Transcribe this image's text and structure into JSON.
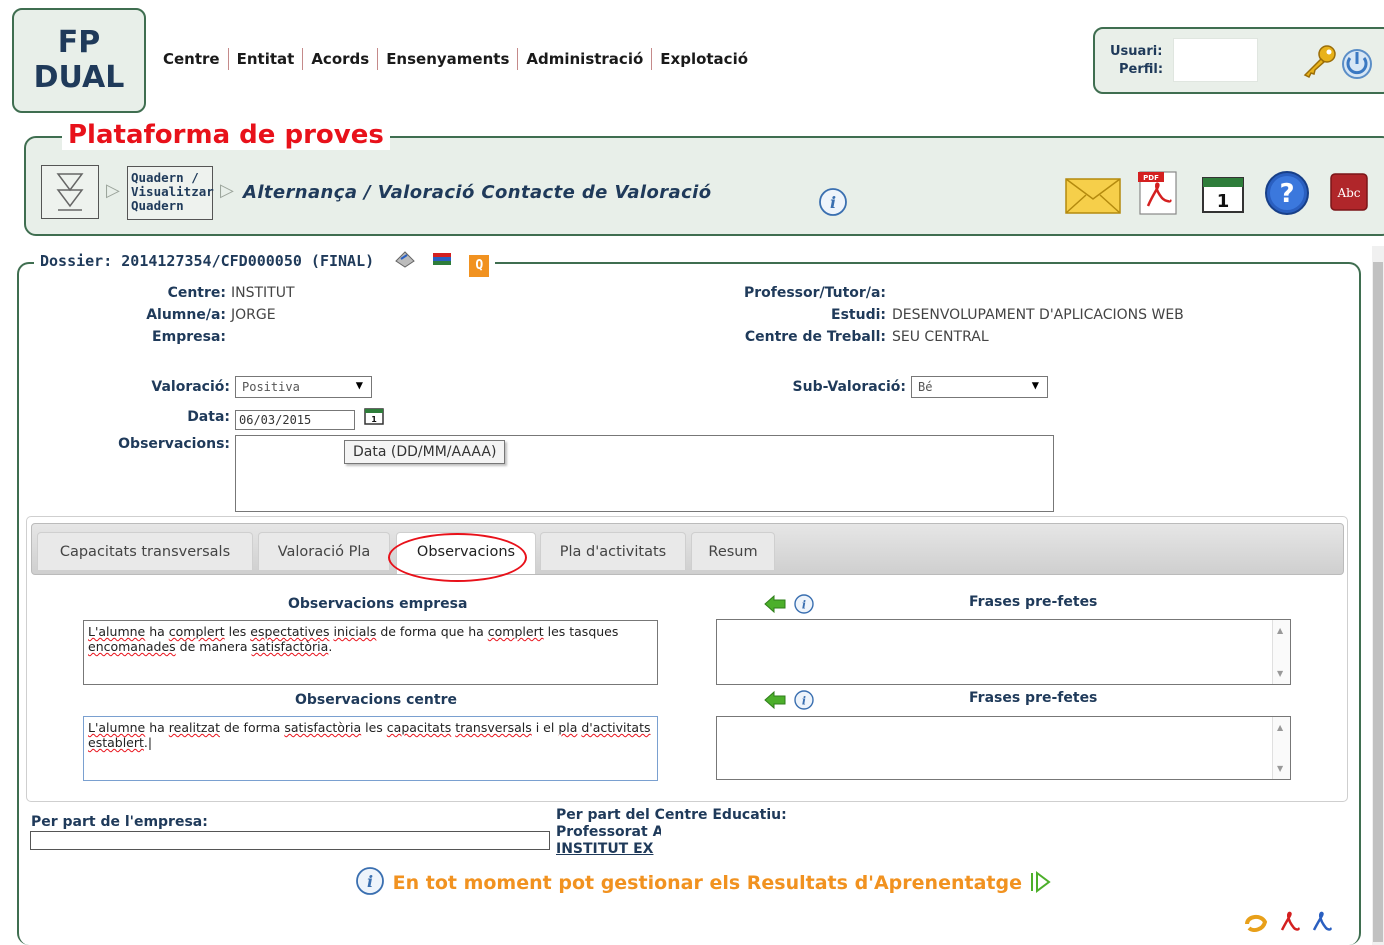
{
  "logo": {
    "line1": "FP",
    "line2": "DUAL"
  },
  "menu": [
    "Centre",
    "Entitat",
    "Acords",
    "Ensenyaments",
    "Administració",
    "Explotació"
  ],
  "user": {
    "usuari_label": "Usuari:",
    "perfil_label": "Perfil:"
  },
  "platform_title": "Plataforma de proves",
  "nav": {
    "box_text": [
      "Quadern /",
      "Visualitzar",
      "Quadern"
    ],
    "breadcrumb": "Alternança / Valoració Contacte de Valoració"
  },
  "toolbar_icons": [
    "mail-icon",
    "pdf-icon",
    "calendar-icon",
    "help-icon",
    "spellcheck-icon"
  ],
  "dossier": "Dossier: 2014127354/CFD000050  (FINAL)",
  "info": {
    "centre_label": "Centre:",
    "centre": "INSTITUT",
    "alumne_label": "Alumne/a:",
    "alumne": "JORGE",
    "empresa_label": "Empresa:",
    "empresa": "",
    "professor_label": "Professor/Tutor/a:",
    "professor": "",
    "estudi_label": "Estudi:",
    "estudi": "DESENVOLUPAMENT D'APLICACIONS WEB",
    "centre_treball_label": "Centre de Treball:",
    "centre_treball": "SEU CENTRAL"
  },
  "form": {
    "valoracio_label": "Valoració:",
    "valoracio": "Positiva",
    "subvaloracio_label": "Sub-Valoració:",
    "subvaloracio": "Bé",
    "data_label": "Data:",
    "data": "06/03/2015",
    "observacions_label": "Observacions:",
    "tooltip": "Data (DD/MM/AAAA)"
  },
  "tabs": [
    "Capacitats transversals",
    "Valoració Pla",
    "Observacions",
    "Pla d'activitats",
    "Resum"
  ],
  "active_tab": "Observacions",
  "observacions": {
    "empresa_title": "Observacions empresa",
    "centre_title": "Observacions centre",
    "frases_title": "Frases pre-fetes",
    "empresa_text": "L'alumne ha complert les espectatives inicials de forma que ha complert les tasques encomanades de manera satisfactòria.",
    "centre_text": "L'alumne ha realitzat de forma satisfactòria les capacitats transversals i el pla d'activitats establert."
  },
  "footer": {
    "empresa_label": "Per part de l'empresa:",
    "centre_label": "Per part del Centre Educatiu:",
    "professorat": "Professorat A",
    "institut": "INSTITUT EX",
    "message": "En tot moment pot gestionar els Resultats d'Aprenentatge"
  },
  "colors": {
    "brand_green": "#3f6e50",
    "title_red": "#e8111a",
    "message_orange": "#f19220",
    "navy": "#1f3a5a"
  }
}
